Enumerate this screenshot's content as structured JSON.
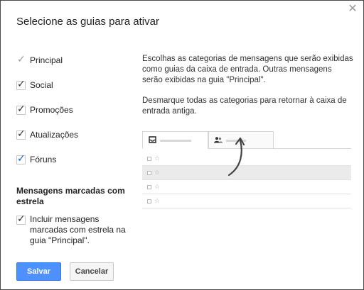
{
  "dialog": {
    "title": "Selecione as guias para ativar",
    "close_icon": "close-icon"
  },
  "tabs": [
    {
      "label": "Principal",
      "checked": true,
      "locked": true
    },
    {
      "label": "Social",
      "checked": true
    },
    {
      "label": "Promoções",
      "checked": true
    },
    {
      "label": "Atualizações",
      "checked": true
    },
    {
      "label": "Fóruns",
      "checked": true,
      "focused": true
    }
  ],
  "starred": {
    "title": "Mensagens marcadas com estrela",
    "option_label": "Incluir mensagens marcadas com estrela na guia \"Principal\".",
    "checked": true
  },
  "description": {
    "p1": "Escolhas as categorias de mensagens que serão exibidas como guias da caixa de entrada. Outras mensagens serão exibidas na guia \"Principal\".",
    "p2": "Desmarque todas as categorias para retornar à caixa de entrada antiga."
  },
  "preview": {
    "tab_icons": [
      "inbox-icon",
      "person-icon"
    ],
    "row_glyph": "☆"
  },
  "buttons": {
    "save": "Salvar",
    "cancel": "Cancelar"
  },
  "colors": {
    "primary": "#4d90fe",
    "checkbox_focus": "#1a5fb4"
  }
}
